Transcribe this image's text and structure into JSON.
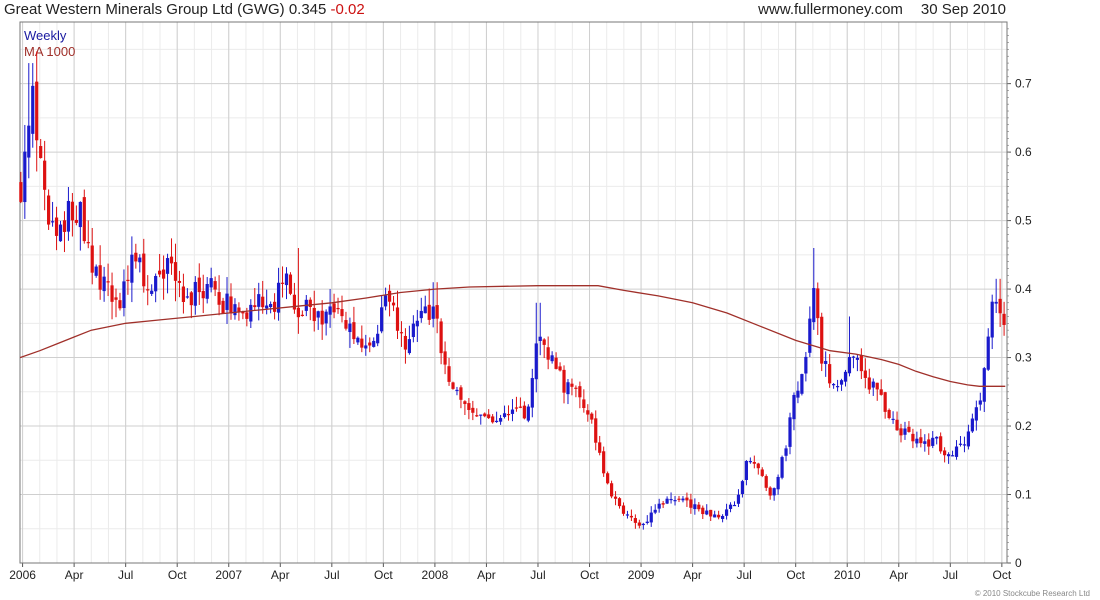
{
  "header": {
    "title": "Great Western Minerals Group Ltd (GWG)",
    "last_price": "0.345",
    "change": "-0.02",
    "site": "www.fullermoney.com",
    "date": "30 Sep 2010"
  },
  "credit": "© 2010 Stockcube Research Ltd",
  "chart_data": {
    "type": "candlestick",
    "period": "Weekly",
    "legend": [
      {
        "label": "Weekly",
        "color": "#1a1aa0"
      },
      {
        "label": "MA 1000",
        "color": "#a0302a"
      }
    ],
    "colors": {
      "up": "#1a1acc",
      "down": "#dd1111",
      "ma": "#a0302a"
    },
    "y_range": [
      0,
      0.79
    ],
    "y_ticks": [
      "0",
      "0.1",
      "0.2",
      "0.3",
      "0.4",
      "0.5",
      "0.6",
      "0.7"
    ],
    "grid": true,
    "x_range": [
      -0.15,
      57.3
    ],
    "x_ticks": [
      {
        "label": "2006",
        "m": 0
      },
      {
        "label": "Apr",
        "m": 3
      },
      {
        "label": "Jul",
        "m": 6
      },
      {
        "label": "Oct",
        "m": 9
      },
      {
        "label": "2007",
        "m": 12
      },
      {
        "label": "Apr",
        "m": 15
      },
      {
        "label": "Jul",
        "m": 18
      },
      {
        "label": "Oct",
        "m": 21
      },
      {
        "label": "2008",
        "m": 24
      },
      {
        "label": "Apr",
        "m": 27
      },
      {
        "label": "Jul",
        "m": 30
      },
      {
        "label": "Oct",
        "m": 33
      },
      {
        "label": "2009",
        "m": 36
      },
      {
        "label": "Apr",
        "m": 39
      },
      {
        "label": "Jul",
        "m": 42
      },
      {
        "label": "Oct",
        "m": 45
      },
      {
        "label": "2010",
        "m": 48
      },
      {
        "label": "Apr",
        "m": 51
      },
      {
        "label": "Jul",
        "m": 54
      },
      {
        "label": "Oct",
        "m": 57
      }
    ],
    "price_path": [
      [
        -2.5,
        0.49
      ],
      [
        -1.8,
        0.45
      ],
      [
        -1.3,
        0.4
      ],
      [
        -0.8,
        0.48
      ],
      [
        -0.3,
        0.5
      ],
      [
        0.2,
        0.62
      ],
      [
        0.5,
        0.7
      ],
      [
        0.8,
        0.64
      ],
      [
        1.2,
        0.56
      ],
      [
        1.6,
        0.48
      ],
      [
        2.2,
        0.48
      ],
      [
        2.8,
        0.52
      ],
      [
        3.3,
        0.52
      ],
      [
        3.8,
        0.45
      ],
      [
        4.5,
        0.41
      ],
      [
        5.0,
        0.4
      ],
      [
        5.5,
        0.37
      ],
      [
        6.0,
        0.4
      ],
      [
        6.5,
        0.45
      ],
      [
        7.0,
        0.42
      ],
      [
        7.5,
        0.4
      ],
      [
        8.0,
        0.43
      ],
      [
        8.6,
        0.43
      ],
      [
        9.0,
        0.41
      ],
      [
        9.5,
        0.39
      ],
      [
        10.5,
        0.4
      ],
      [
        11.0,
        0.4
      ],
      [
        11.5,
        0.38
      ],
      [
        12.0,
        0.38
      ],
      [
        13.0,
        0.37
      ],
      [
        14.0,
        0.38
      ],
      [
        14.6,
        0.36
      ],
      [
        15.3,
        0.44
      ],
      [
        15.8,
        0.38
      ],
      [
        16.4,
        0.37
      ],
      [
        17.0,
        0.36
      ],
      [
        18.0,
        0.37
      ],
      [
        19.0,
        0.34
      ],
      [
        20.0,
        0.32
      ],
      [
        20.6,
        0.31
      ],
      [
        21.0,
        0.4
      ],
      [
        21.5,
        0.37
      ],
      [
        22.3,
        0.31
      ],
      [
        23.0,
        0.37
      ],
      [
        24.0,
        0.36
      ],
      [
        24.6,
        0.28
      ],
      [
        25.2,
        0.26
      ],
      [
        25.8,
        0.22
      ],
      [
        26.5,
        0.21
      ],
      [
        27.3,
        0.21
      ],
      [
        28.0,
        0.21
      ],
      [
        28.8,
        0.22
      ],
      [
        29.4,
        0.22
      ],
      [
        30.0,
        0.34
      ],
      [
        30.8,
        0.3
      ],
      [
        31.5,
        0.26
      ],
      [
        32.2,
        0.26
      ],
      [
        32.8,
        0.23
      ],
      [
        33.3,
        0.19
      ],
      [
        33.8,
        0.13
      ],
      [
        34.3,
        0.1
      ],
      [
        34.8,
        0.08
      ],
      [
        35.5,
        0.06
      ],
      [
        36.3,
        0.06
      ],
      [
        37.0,
        0.08
      ],
      [
        37.8,
        0.1
      ],
      [
        38.5,
        0.09
      ],
      [
        39.3,
        0.08
      ],
      [
        40.0,
        0.07
      ],
      [
        40.8,
        0.07
      ],
      [
        41.6,
        0.09
      ],
      [
        42.2,
        0.15
      ],
      [
        42.8,
        0.14
      ],
      [
        43.5,
        0.1
      ],
      [
        44.0,
        0.13
      ],
      [
        44.5,
        0.18
      ],
      [
        45.0,
        0.25
      ],
      [
        45.5,
        0.28
      ],
      [
        46.0,
        0.4
      ],
      [
        46.5,
        0.3
      ],
      [
        47.0,
        0.27
      ],
      [
        47.6,
        0.27
      ],
      [
        48.0,
        0.29
      ],
      [
        48.5,
        0.3
      ],
      [
        49.0,
        0.27
      ],
      [
        49.5,
        0.26
      ],
      [
        50.0,
        0.24
      ],
      [
        50.6,
        0.21
      ],
      [
        51.3,
        0.19
      ],
      [
        52.0,
        0.18
      ],
      [
        52.6,
        0.17
      ],
      [
        53.1,
        0.18
      ],
      [
        53.7,
        0.16
      ],
      [
        54.2,
        0.16
      ],
      [
        54.7,
        0.17
      ],
      [
        55.1,
        0.19
      ],
      [
        55.5,
        0.22
      ],
      [
        55.9,
        0.26
      ],
      [
        56.3,
        0.36
      ],
      [
        56.7,
        0.4
      ],
      [
        57.0,
        0.36
      ],
      [
        57.2,
        0.345
      ]
    ],
    "spikes": [
      [
        0.5,
        0.73
      ],
      [
        16.0,
        0.46
      ],
      [
        24.0,
        0.41
      ],
      [
        30.0,
        0.38
      ],
      [
        46.0,
        0.46
      ],
      [
        48.2,
        0.36
      ],
      [
        56.8,
        0.415
      ]
    ],
    "ma_path": [
      [
        -0.15,
        0.3
      ],
      [
        1.0,
        0.31
      ],
      [
        2.0,
        0.32
      ],
      [
        3.0,
        0.33
      ],
      [
        4.0,
        0.34
      ],
      [
        6.0,
        0.35
      ],
      [
        8.0,
        0.355
      ],
      [
        10.0,
        0.36
      ],
      [
        12.0,
        0.365
      ],
      [
        14.0,
        0.37
      ],
      [
        16.0,
        0.375
      ],
      [
        18.0,
        0.38
      ],
      [
        20.0,
        0.387
      ],
      [
        22.0,
        0.395
      ],
      [
        24.0,
        0.4
      ],
      [
        26.0,
        0.403
      ],
      [
        28.0,
        0.404
      ],
      [
        30.0,
        0.405
      ],
      [
        32.0,
        0.405
      ],
      [
        33.5,
        0.405
      ],
      [
        35.0,
        0.398
      ],
      [
        37.0,
        0.39
      ],
      [
        39.0,
        0.38
      ],
      [
        41.0,
        0.365
      ],
      [
        43.0,
        0.345
      ],
      [
        45.0,
        0.325
      ],
      [
        47.0,
        0.31
      ],
      [
        48.5,
        0.305
      ],
      [
        50.0,
        0.297
      ],
      [
        51.0,
        0.29
      ],
      [
        52.0,
        0.28
      ],
      [
        53.0,
        0.272
      ],
      [
        54.0,
        0.265
      ],
      [
        55.0,
        0.26
      ],
      [
        55.7,
        0.258
      ],
      [
        57.2,
        0.258
      ]
    ]
  }
}
